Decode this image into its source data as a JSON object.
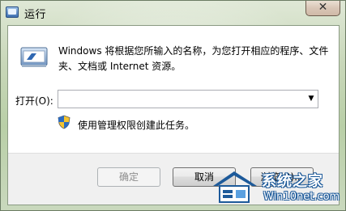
{
  "window": {
    "title": "运行",
    "close_glyph": "✕"
  },
  "dialog": {
    "description": "Windows 将根据您所输入的名称，为您打开相应的程序、文件夹、文档或 Internet 资源。",
    "open_label": "打开(O):",
    "open_value": "",
    "admin_note": "使用管理权限创建此任务。",
    "icons": [
      "run-program-icon",
      "uac-shield-icon",
      "chevron-down-icon"
    ]
  },
  "buttons": {
    "ok": "确定",
    "cancel": "取消",
    "browse": "浏览(B)..."
  },
  "watermark": {
    "name": "系统之家",
    "url": "Win10net.com",
    "accent": "#1d5a9a"
  }
}
